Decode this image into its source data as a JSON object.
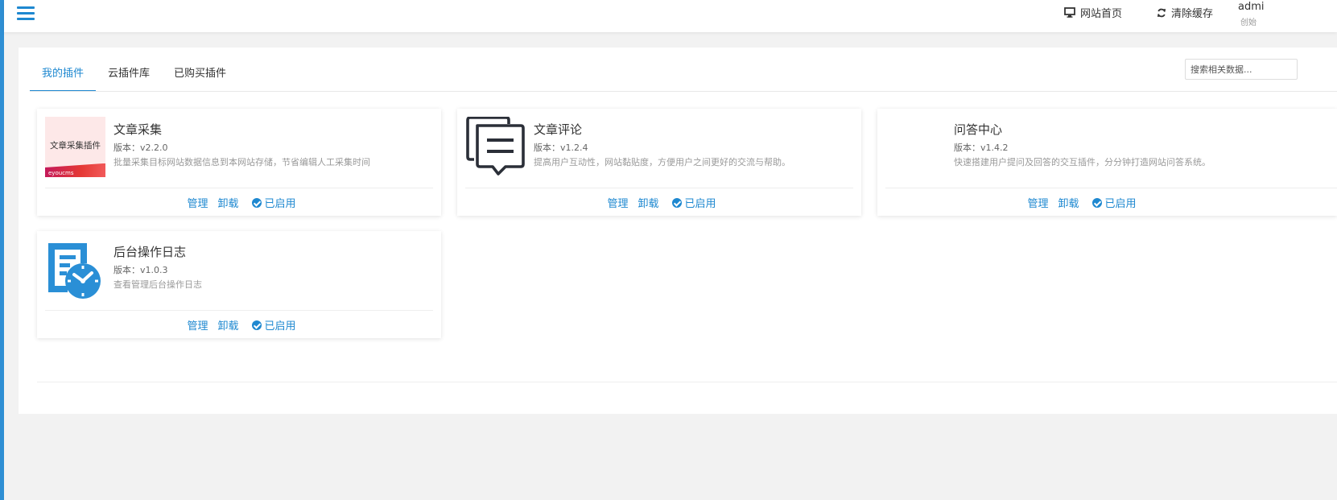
{
  "header": {
    "home_label": "网站首页",
    "clear_cache_label": "清除缓存",
    "user_name": "admi",
    "user_role": "创始"
  },
  "tabs": [
    {
      "label": "我的插件",
      "active": true
    },
    {
      "label": "云插件库",
      "active": false
    },
    {
      "label": "已购买插件",
      "active": false
    }
  ],
  "search": {
    "placeholder": "搜索相关数据..."
  },
  "plugins": [
    {
      "title": "文章采集",
      "version": "版本：v2.2.0",
      "description": "批量采集目标网站数据信息到本网站存储，节省编辑人工采集时间",
      "thumb_text": "文章采集插件",
      "thumb_brand": "eyoucms",
      "manage_label": "管理",
      "uninstall_label": "卸载",
      "status_label": "已启用"
    },
    {
      "title": "文章评论",
      "version": "版本：v1.2.4",
      "description": "提高用户互动性，网站黏贴度，方便用户之间更好的交流与帮助。",
      "manage_label": "管理",
      "uninstall_label": "卸载",
      "status_label": "已启用"
    },
    {
      "title": "问答中心",
      "version": "版本：v1.4.2",
      "description": "快速搭建用户提问及回答的交互插件，分分钟打造网站问答系统。",
      "manage_label": "管理",
      "uninstall_label": "卸载",
      "status_label": "已启用"
    },
    {
      "title": "后台操作日志",
      "version": "版本：v1.0.3",
      "description": "查看管理后台操作日志",
      "manage_label": "管理",
      "uninstall_label": "卸载",
      "status_label": "已启用"
    }
  ],
  "colors": {
    "accent": "#1e88d0",
    "sidebar_strip": "#2f8fd4",
    "background": "#f2f2f2"
  }
}
